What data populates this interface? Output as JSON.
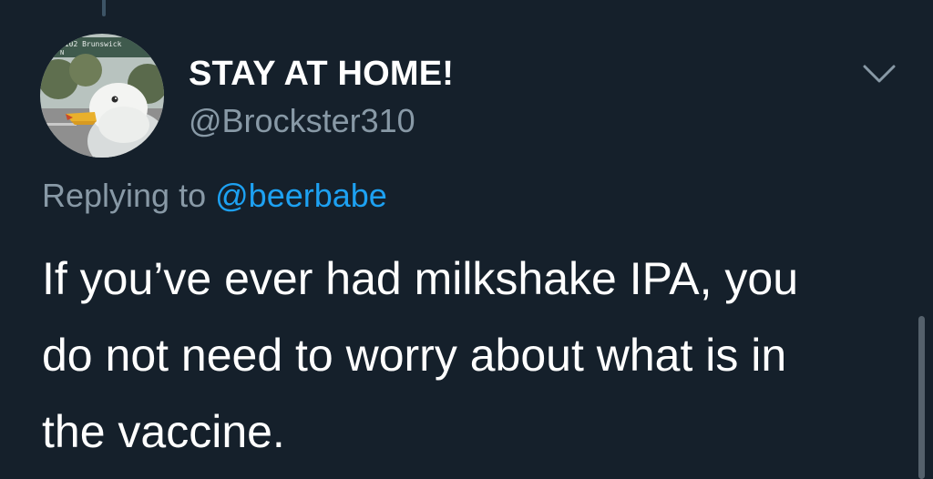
{
  "tweet": {
    "author": {
      "display_name": "STAY AT HOME!",
      "handle": "@Brockster310",
      "avatar_icon": "seagull-avatar",
      "avatar_sign_text": "A102 Brunswick",
      "avatar_sign_sub": "N"
    },
    "more_icon": "chevron-down-icon",
    "reply": {
      "prefix": "Replying to",
      "mention": "@beerbabe"
    },
    "text_lines": [
      "If you’ve ever had milkshake IPA, you",
      "do not need to worry about what is in",
      "the vaccine."
    ]
  },
  "colors": {
    "background": "#15202b",
    "primary_text": "#ffffff",
    "secondary_text": "#8899a6",
    "accent": "#1da1f2"
  }
}
